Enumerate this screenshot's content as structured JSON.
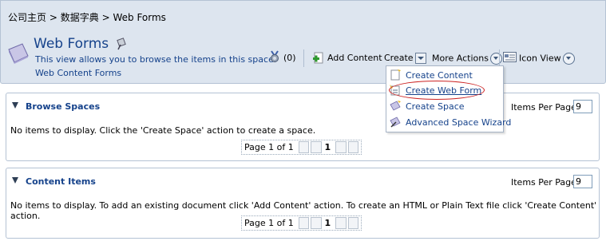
{
  "breadcrumb": {
    "home": "公司主页",
    "sep1": ">",
    "dict": "数据字典",
    "sep2": ">",
    "current": "Web Forms"
  },
  "header": {
    "title": "Web Forms",
    "description": "This view allows you to browse the items in this space.",
    "subtitle": "Web Content Forms",
    "rules_count": "(0)"
  },
  "toolbar": {
    "add_content": "Add Content",
    "create": "Create",
    "more_actions": "More Actions",
    "icon_view": "Icon View"
  },
  "create_menu": {
    "items": [
      {
        "label": "Create Content",
        "icon": "create-content-icon"
      },
      {
        "label": "Create Web Form",
        "icon": "create-web-form-icon"
      },
      {
        "label": "Create Space",
        "icon": "create-space-icon"
      },
      {
        "label": "Advanced Space Wizard",
        "icon": "space-wizard-icon"
      }
    ]
  },
  "browse_spaces": {
    "title": "Browse Spaces",
    "items_per_page_label": "Items Per Page",
    "items_per_page": "9",
    "empty_message": "No items to display. Click the 'Create Space' action to create a space.",
    "pager": {
      "label": "Page 1 of 1",
      "current": "1"
    }
  },
  "content_items": {
    "title": "Content Items",
    "items_per_page_label": "Items Per Page",
    "items_per_page": "9",
    "empty_message": "No items to display. To add an existing document click 'Add Content' action. To create an HTML or Plain Text file click 'Create Content' action.",
    "pager": {
      "label": "Page 1 of 1",
      "current": "1"
    }
  },
  "colors": {
    "header_bg": "#dde5ef",
    "title_blue": "#15428b",
    "border": "#b4c2d4",
    "highlight_ring": "#cc2222"
  }
}
